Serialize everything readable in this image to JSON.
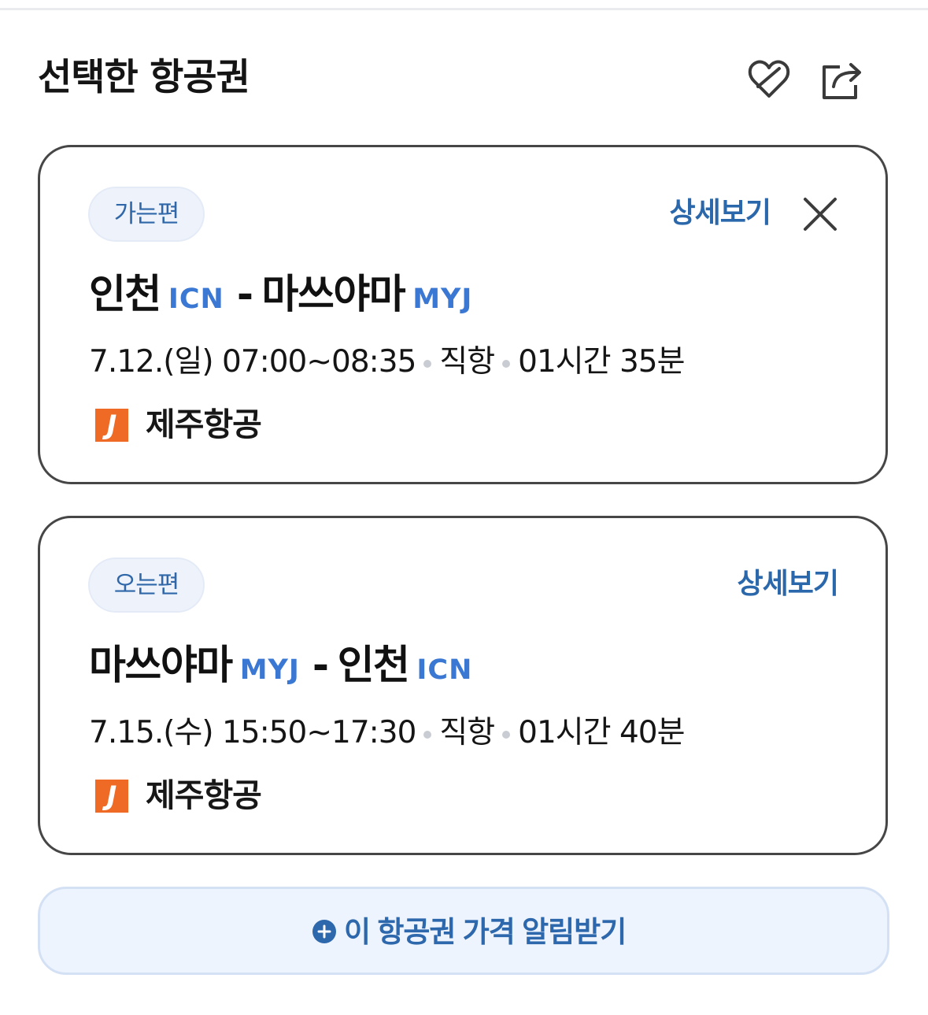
{
  "header": {
    "title": "선택한 항공권",
    "favorite_icon": "heart-icon",
    "share_icon": "share-icon"
  },
  "flights": {
    "outbound": {
      "badge": "가는편",
      "details_label": "상세보기",
      "close_icon": "close-icon",
      "departure_city": "인천",
      "departure_code": "ICN",
      "separator": "-",
      "arrival_city": "마쓰야마",
      "arrival_code": "MYJ",
      "date_time": "7.12.(일) 07:00~08:35",
      "flight_type": "직항",
      "duration": "01시간 35분",
      "airline": "제주항공",
      "airline_logo_text": "J"
    },
    "return": {
      "badge": "오는편",
      "details_label": "상세보기",
      "departure_city": "마쓰야마",
      "departure_code": "MYJ",
      "separator": "-",
      "arrival_city": "인천",
      "arrival_code": "ICN",
      "date_time": "7.15.(수) 15:50~17:30",
      "flight_type": "직항",
      "duration": "01시간 40분",
      "airline": "제주항공",
      "airline_logo_text": "J"
    }
  },
  "alert": {
    "label": "이 항공권 가격 알림받기",
    "icon": "plus-circle-icon"
  },
  "colors": {
    "accent_blue": "#2b68ab",
    "code_blue": "#3b78d3",
    "badge_bg": "#eef3fb",
    "alert_bg": "#edf4fd",
    "airline_orange": "#ef6a24",
    "border_dark": "#464646"
  }
}
